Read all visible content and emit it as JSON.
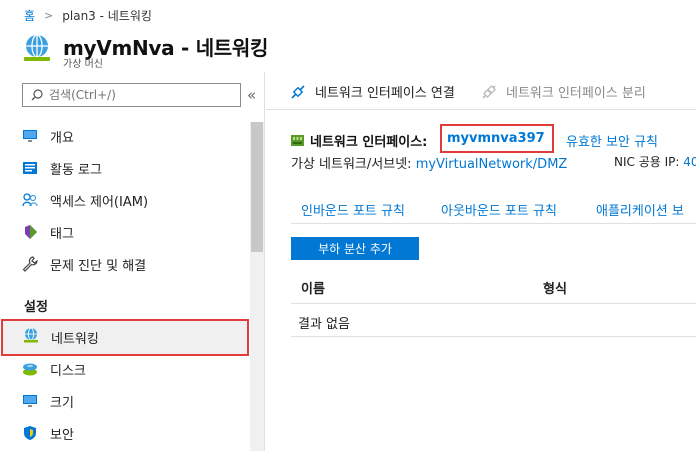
{
  "breadcrumb": {
    "home": "홈",
    "current": "plan3 - 네트워킹"
  },
  "header": {
    "title": "myVmNva - 네트워킹",
    "subtitle": "가상 머신"
  },
  "sidebar": {
    "search_placeholder": "검색(Ctrl+/)",
    "collapse_glyph": "«",
    "items": [
      {
        "label": "개요",
        "icon": "monitor-icon"
      },
      {
        "label": "활동 로그",
        "icon": "activity-log-icon"
      },
      {
        "label": "액세스 제어(IAM)",
        "icon": "iam-people-icon"
      },
      {
        "label": "태그",
        "icon": "tag-icon"
      },
      {
        "label": "문제 진단 및 해결",
        "icon": "wrench-icon"
      }
    ],
    "section_settings": "설정",
    "settings_items": [
      {
        "label": "네트워킹",
        "icon": "networking-globe-icon",
        "selected": true
      },
      {
        "label": "디스크",
        "icon": "disk-icon"
      },
      {
        "label": "크기",
        "icon": "size-monitor-icon"
      },
      {
        "label": "보안",
        "icon": "shield-icon"
      }
    ]
  },
  "toolbar": {
    "attach_label": "네트워크 인터페이스 연결",
    "detach_label": "네트워크 인터페이스 분리"
  },
  "nic": {
    "label": "네트워크 인터페이스:",
    "name": "myvmnva397",
    "effective_rules": "유효한 보안 규칙",
    "vnet_label": "가상 네트워크/서브넷:",
    "vnet_value": "myVirtualNetwork/DMZ",
    "public_ip_label": "NIC 공용 IP:",
    "public_ip_value": "40"
  },
  "tabs": [
    "인바운드 포트 규칙",
    "아웃바운드 포트 규칙",
    "애플리케이션 보"
  ],
  "add_lb_button": "부하 분산 추가",
  "table": {
    "columns": [
      "이름",
      "형식"
    ],
    "empty_text": "결과 없음"
  },
  "colors": {
    "accent": "#0078d4",
    "highlight": "#e03c3c"
  }
}
